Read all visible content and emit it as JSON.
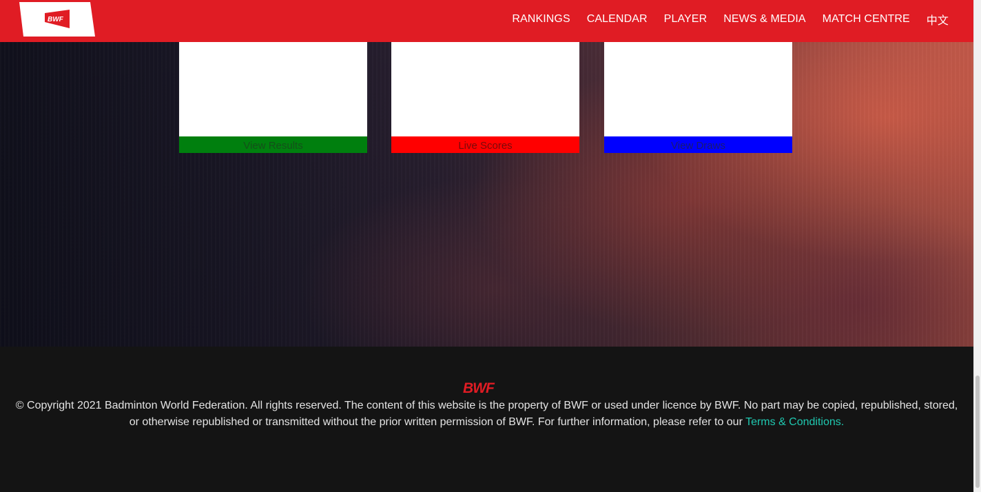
{
  "logo": {
    "text": "BWF",
    "brand_color": "#e01c24"
  },
  "nav": {
    "items": [
      "RANKINGS",
      "CALENDAR",
      "PLAYER",
      "NEWS & MEDIA",
      "MATCH CENTRE",
      "中文"
    ]
  },
  "cards": {
    "results": {
      "label": "View Results",
      "color": "#007f0e"
    },
    "live": {
      "label": "Live Scores",
      "color": "#ff0000"
    },
    "draws": {
      "label": "View Draws",
      "color": "#0000ff"
    }
  },
  "footer": {
    "logo_text": "BWF",
    "copyright": "© Copyright 2021 Badminton World Federation. All rights reserved. The content of this website is the property of BWF or used under licence by BWF. No part may be copied, republished, stored, or otherwise republished or transmitted without the prior written permission of BWF. For further information, please refer to our ",
    "terms_link": "Terms & Conditions.",
    "link_color": "#1fc8b0"
  }
}
